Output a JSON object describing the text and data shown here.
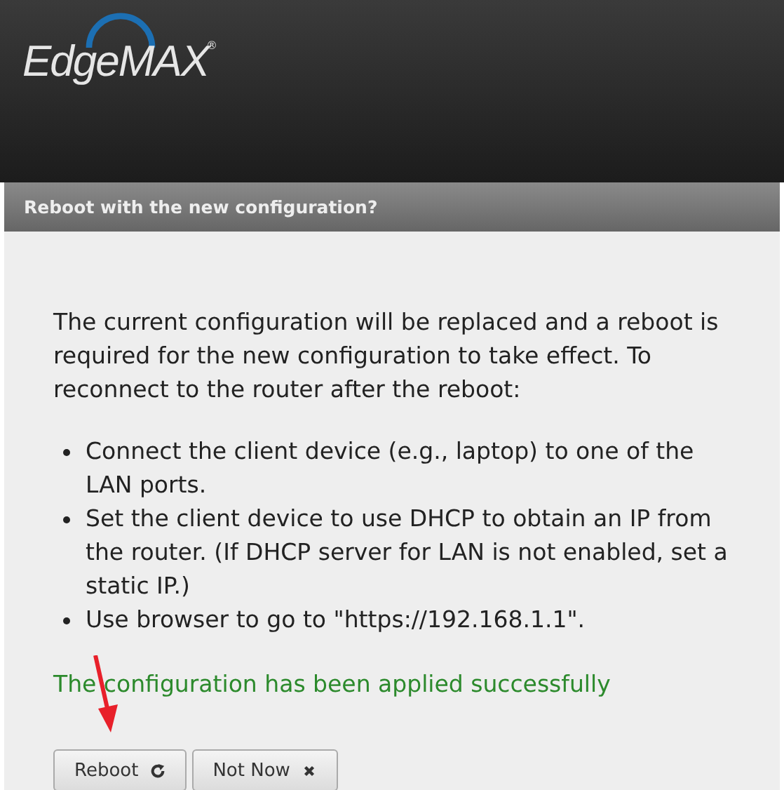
{
  "header": {
    "logo": "EdgeMAX",
    "trademark": "®"
  },
  "dialog": {
    "title": "Reboot with the new configuration?",
    "message": "The current configuration will be replaced and a reboot is required for the new configuration to take effect. To reconnect to the router after the reboot:",
    "steps": [
      "Connect the client device (e.g., laptop) to one of the LAN ports.",
      "Set the client device to use DHCP to obtain an IP from the router. (If DHCP server for LAN is not enabled, set a static IP.)",
      "Use browser to go to \"https://192.168.1.1\"."
    ],
    "status": "The configuration has been applied successfully",
    "buttons": [
      {
        "label": "Reboot",
        "kind": "refresh"
      },
      {
        "label": "Not Now",
        "kind": "close"
      }
    ]
  }
}
